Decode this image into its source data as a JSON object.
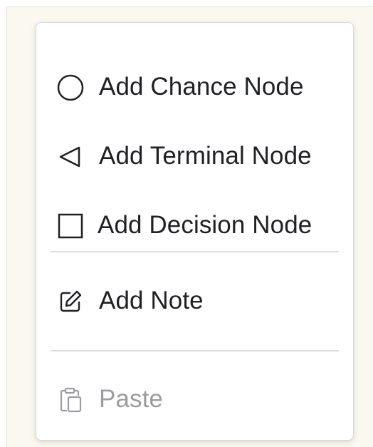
{
  "context_menu": {
    "items": [
      {
        "label": "Add Chance Node",
        "icon": "circle-icon",
        "enabled": true
      },
      {
        "label": "Add Terminal Node",
        "icon": "triangle-left-icon",
        "enabled": true
      },
      {
        "label": "Add Decision Node",
        "icon": "square-icon",
        "enabled": true
      },
      {
        "label": "Add Note",
        "icon": "edit-note-icon",
        "enabled": true
      },
      {
        "label": "Paste",
        "icon": "paste-icon",
        "enabled": false
      }
    ]
  },
  "colors": {
    "canvas_background": "#fbf9ef",
    "menu_background": "#ffffff",
    "text": "#202124",
    "disabled_text": "#9a9ca0",
    "separator": "#d9dbe6"
  }
}
